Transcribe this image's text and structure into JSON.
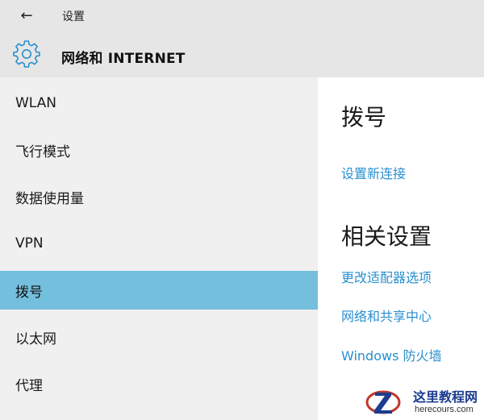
{
  "window": {
    "back_glyph": "←",
    "title": "设置"
  },
  "header": {
    "section_title": "网络和 INTERNET",
    "icon": "gear-icon",
    "accent": "#2a8fcf"
  },
  "sidebar": {
    "items": [
      {
        "label": "WLAN"
      },
      {
        "label": "飞行模式"
      },
      {
        "label": "数据使用量"
      },
      {
        "label": "VPN"
      },
      {
        "label": "拨号",
        "active": true
      },
      {
        "label": "以太网"
      },
      {
        "label": "代理"
      }
    ],
    "active_color": "#74bfdd"
  },
  "content": {
    "heading": "拨号",
    "setup_link": "设置新连接",
    "related_heading": "相关设置",
    "related_links": [
      {
        "label": "更改适配器选项"
      },
      {
        "label": "网络和共享中心"
      },
      {
        "label": "Windows 防火墙"
      }
    ],
    "link_color": "#2a8fcf"
  },
  "watermark": {
    "title": "这里教程网",
    "url": "herecours.com"
  }
}
